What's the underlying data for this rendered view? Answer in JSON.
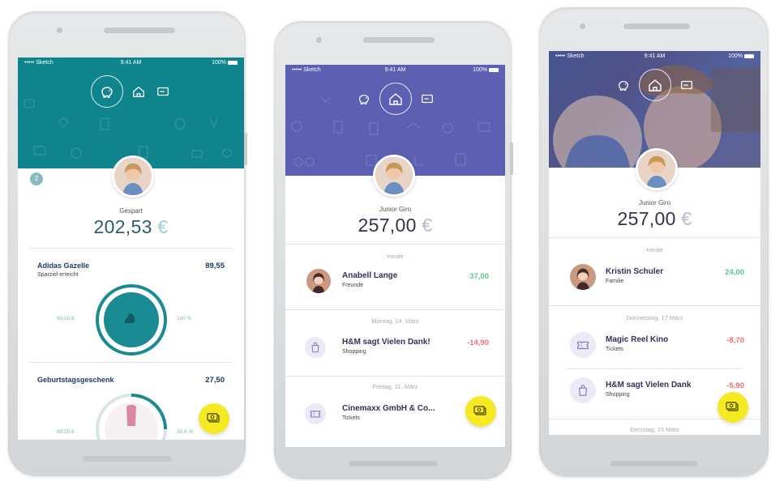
{
  "status_bar": {
    "carrier": "••••• Sketch",
    "time": "9:41 AM",
    "battery": "100%"
  },
  "colors": {
    "teal": "#10848c",
    "purple": "#5c5fb2",
    "yellow": "#f5ea24",
    "positive": "#5cc48c",
    "negative": "#ef6f6f"
  },
  "screen1": {
    "badge": "2",
    "balance_label": "Gespart",
    "balance_amount": "202,53",
    "currency": "€",
    "goals": [
      {
        "name": "Adidas Gazelle",
        "subtitle": "Sparziel erreicht",
        "amount": "89,55",
        "left_value": "89,55 €",
        "right_value": "100 %",
        "progress": 1.0
      },
      {
        "name": "Geburtstagsgeschenk",
        "amount": "27,50",
        "left_value": "89,55 €",
        "right_value": "30,6 %",
        "progress": 0.306
      }
    ]
  },
  "screen2": {
    "balance_label": "Junior Giro",
    "balance_amount": "257,00",
    "currency": "€",
    "sections": [
      {
        "date": "Heute",
        "transactions": [
          {
            "name": "Anabell Lange",
            "category": "Freunde",
            "amount": "37,00",
            "type": "positive",
            "icon": "person-avatar"
          }
        ]
      },
      {
        "date": "Montag, 14. März",
        "transactions": [
          {
            "name": "H&M sagt Vielen Dank!",
            "category": "Shopping",
            "amount": "-14,90",
            "type": "negative",
            "icon": "shopping-bag-icon"
          }
        ]
      },
      {
        "date": "Freitag, 11. März",
        "transactions": [
          {
            "name": "Cinemaxx GmbH & Co...",
            "category": "Tickets",
            "amount": "",
            "type": "negative",
            "icon": "ticket-icon"
          }
        ]
      }
    ]
  },
  "screen3": {
    "balance_label": "Junior Giro",
    "balance_amount": "257,00",
    "currency": "€",
    "sections": [
      {
        "date": "Heute",
        "transactions": [
          {
            "name": "Kristin Schuler",
            "category": "Familie",
            "amount": "24,00",
            "type": "positive",
            "icon": "person-avatar"
          }
        ]
      },
      {
        "date": "Donnerstag, 17 März",
        "transactions": [
          {
            "name": "Magic Reel Kino",
            "category": "Tickets",
            "amount": "-8,70",
            "type": "negative",
            "icon": "ticket-icon"
          },
          {
            "name": "H&M sagt Vielen Dank",
            "category": "Shopping",
            "amount": "-5,90",
            "type": "negative",
            "icon": "shopping-bag-icon"
          }
        ]
      },
      {
        "date": "Dienstag, 15 März",
        "transactions": []
      }
    ]
  },
  "nav_icons": [
    "piggy-bank-icon",
    "house-icon",
    "card-icon"
  ],
  "fab_icon": "money-transfer-icon"
}
